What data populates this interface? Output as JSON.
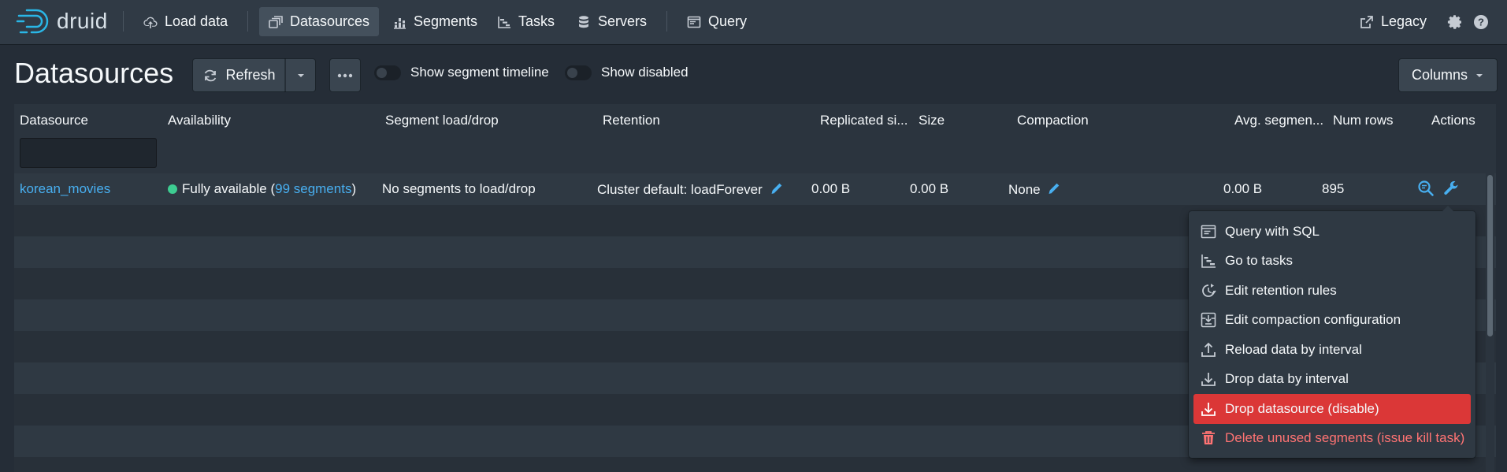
{
  "app": {
    "logo_text": "druid"
  },
  "nav": {
    "load_data": "Load data",
    "datasources": "Datasources",
    "segments": "Segments",
    "tasks": "Tasks",
    "servers": "Servers",
    "query": "Query",
    "legacy": "Legacy"
  },
  "page": {
    "title": "Datasources",
    "refresh_label": "Refresh",
    "show_segment_timeline": "Show segment timeline",
    "show_disabled": "Show disabled",
    "columns_label": "Columns"
  },
  "table": {
    "headers": [
      "Datasource",
      "Availability",
      "Segment load/drop",
      "Retention",
      "Replicated si...",
      "Size",
      "Compaction",
      "Avg. segmen...",
      "Num rows",
      "Actions"
    ],
    "rows": [
      {
        "datasource": "korean_movies",
        "availability_prefix": "Fully available (",
        "availability_link": "99 segments",
        "availability_suffix": ")",
        "segment_load_drop": "No segments to load/drop",
        "retention": "Cluster default: loadForever",
        "replicated_size": "0.00 B",
        "size": "0.00 B",
        "compaction": "None",
        "avg_segment_size": "0.00 B",
        "num_rows": "895"
      }
    ]
  },
  "actions_menu": {
    "items": [
      {
        "label": "Query with SQL",
        "icon": "application-icon"
      },
      {
        "label": "Go to tasks",
        "icon": "gantt-chart-icon"
      },
      {
        "label": "Edit retention rules",
        "icon": "automatic-updates-icon"
      },
      {
        "label": "Edit compaction configuration",
        "icon": "compressed-icon"
      },
      {
        "label": "Reload data by interval",
        "icon": "import-icon"
      },
      {
        "label": "Drop data by interval",
        "icon": "export-icon"
      },
      {
        "label": "Drop datasource (disable)",
        "icon": "export-icon"
      },
      {
        "label": "Delete unused segments (issue kill task)",
        "icon": "trash-icon"
      }
    ]
  },
  "colors": {
    "link": "#48aff0",
    "available": "#3dcc91",
    "danger": "#db3737",
    "danger_text": "#ff7373",
    "nav_bg": "#303a45",
    "page_bg": "#252d37"
  }
}
